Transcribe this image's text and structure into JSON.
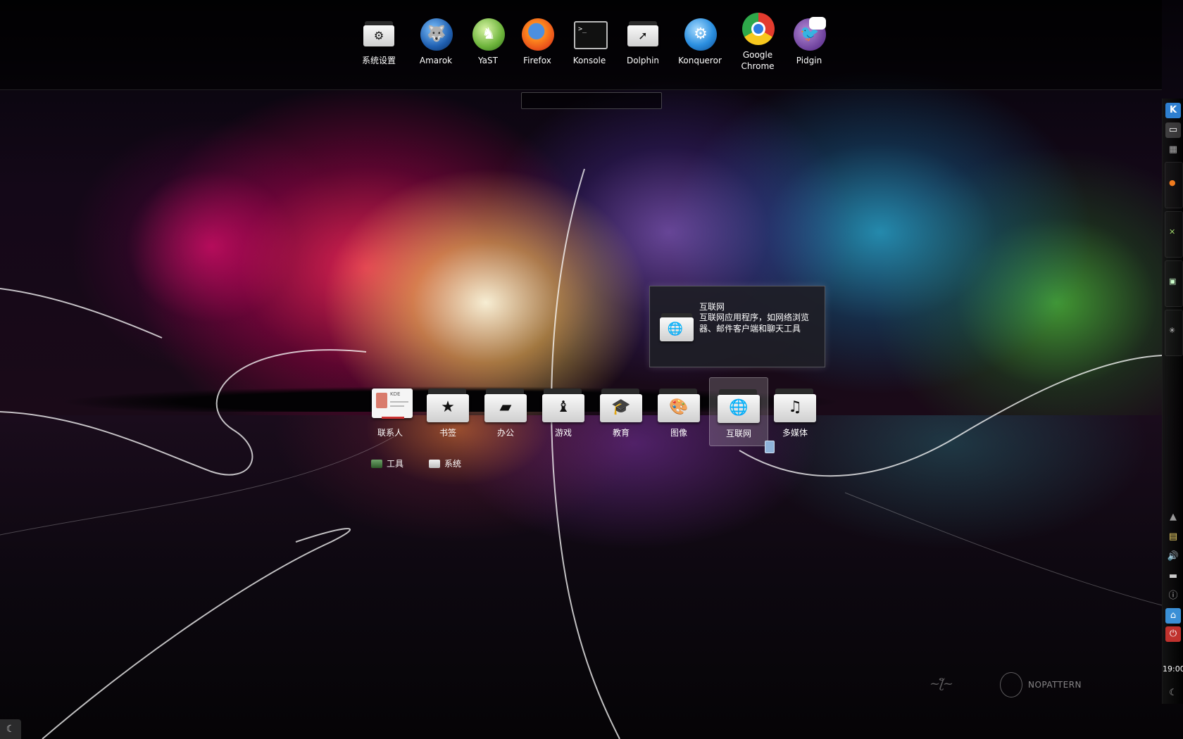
{
  "favorites": [
    {
      "label": "系统设置",
      "icon": "settings-folder-icon"
    },
    {
      "label": "Amarok",
      "icon": "amarok-icon"
    },
    {
      "label": "YaST",
      "icon": "yast-icon"
    },
    {
      "label": "Firefox",
      "icon": "firefox-icon"
    },
    {
      "label": "Konsole",
      "icon": "terminal-icon"
    },
    {
      "label": "Dolphin",
      "icon": "dolphin-folder-icon"
    },
    {
      "label": "Konqueror",
      "icon": "konqueror-globe-icon"
    },
    {
      "label": "Google Chrome",
      "icon": "chrome-icon"
    },
    {
      "label": "Pidgin",
      "icon": "pidgin-icon"
    }
  ],
  "search": {
    "value": "",
    "placeholder": ""
  },
  "categories": [
    {
      "label": "联系人",
      "icon": "contact-card-icon"
    },
    {
      "label": "书签",
      "icon": "star-folder-icon"
    },
    {
      "label": "办公",
      "icon": "office-folder-icon"
    },
    {
      "label": "游戏",
      "icon": "chess-folder-icon"
    },
    {
      "label": "教育",
      "icon": "graduation-cap-folder-icon"
    },
    {
      "label": "图像",
      "icon": "palette-folder-icon"
    },
    {
      "label": "互联网",
      "icon": "internet-folder-icon"
    },
    {
      "label": "多媒体",
      "icon": "multimedia-folder-icon"
    }
  ],
  "subcategories": [
    {
      "label": "工具",
      "icon": "utilities-icon"
    },
    {
      "label": "系统",
      "icon": "system-icon"
    }
  ],
  "tooltip": {
    "title": "互联网",
    "description": "互联网应用程序，如网络浏览器、邮件客户端和聊天工具"
  },
  "panel": {
    "clock": "19:00"
  },
  "wallpaper": {
    "signature_text": "NOPATTERN"
  },
  "colors": {
    "accent": "#3a8fd6",
    "tooltip_bg": "#1e1e26",
    "power": "#c0322e"
  }
}
